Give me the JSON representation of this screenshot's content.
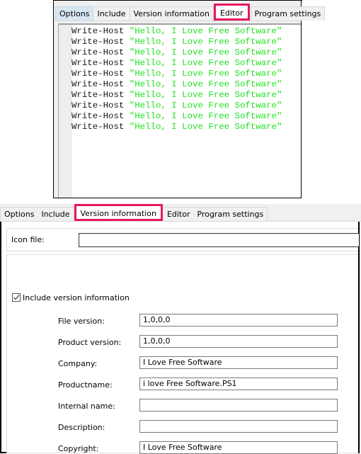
{
  "top_window": {
    "tabs": [
      {
        "label": "Options",
        "state": "hover"
      },
      {
        "label": "Include",
        "state": "normal"
      },
      {
        "label": "Version information",
        "state": "normal"
      },
      {
        "label": "Editor",
        "state": "active"
      },
      {
        "label": "Program settings",
        "state": "normal"
      }
    ],
    "editor": {
      "lines": [
        {
          "cmd": "Write-Host",
          "str": "\"Hello, I Love Free Software\""
        },
        {
          "cmd": "Write-Host",
          "str": "\"Hello, I Love Free Software\""
        },
        {
          "cmd": "Write-Host",
          "str": "\"Hello, I Love Free Software\""
        },
        {
          "cmd": "Write-Host",
          "str": "\"Hello, I Love Free Software\""
        },
        {
          "cmd": "Write-Host",
          "str": "\"Hello, I Love Free Software\""
        },
        {
          "cmd": "Write-Host",
          "str": "\"Hello, I Love Free Software\""
        },
        {
          "cmd": "Write-Host",
          "str": "\"Hello, I Love Free Software\""
        },
        {
          "cmd": "Write-Host",
          "str": "\"Hello, I Love Free Software\""
        },
        {
          "cmd": "Write-Host",
          "str": "\"Hello, I Love Free Software\""
        },
        {
          "cmd": "Write-Host",
          "str": "\"Hello, I Love Free Software\""
        }
      ],
      "colors": {
        "command": "#1a1a1a",
        "string": "#22e322"
      }
    }
  },
  "bottom_window": {
    "tabs": [
      {
        "label": "Options",
        "state": "normal"
      },
      {
        "label": "Include",
        "state": "normal"
      },
      {
        "label": "Version information",
        "state": "active"
      },
      {
        "label": "Editor",
        "state": "normal"
      },
      {
        "label": "Program settings",
        "state": "normal"
      }
    ],
    "icon_file": {
      "label": "Icon file:",
      "value": ""
    },
    "include_version": {
      "label": "Include version information",
      "checked": true
    },
    "fields": [
      {
        "label": "File version:",
        "value": "1,0,0,0"
      },
      {
        "label": "Product version:",
        "value": "1,0,0,0"
      },
      {
        "label": "Company:",
        "value": "I Love Free Software"
      },
      {
        "label": "Productname:",
        "value": "i love Free Software.PS1"
      },
      {
        "label": "Internal name:",
        "value": ""
      },
      {
        "label": "Description:",
        "value": ""
      },
      {
        "label": "Copyright:",
        "value": "I Love Free Software"
      }
    ]
  },
  "highlight_color": "#e8195a"
}
